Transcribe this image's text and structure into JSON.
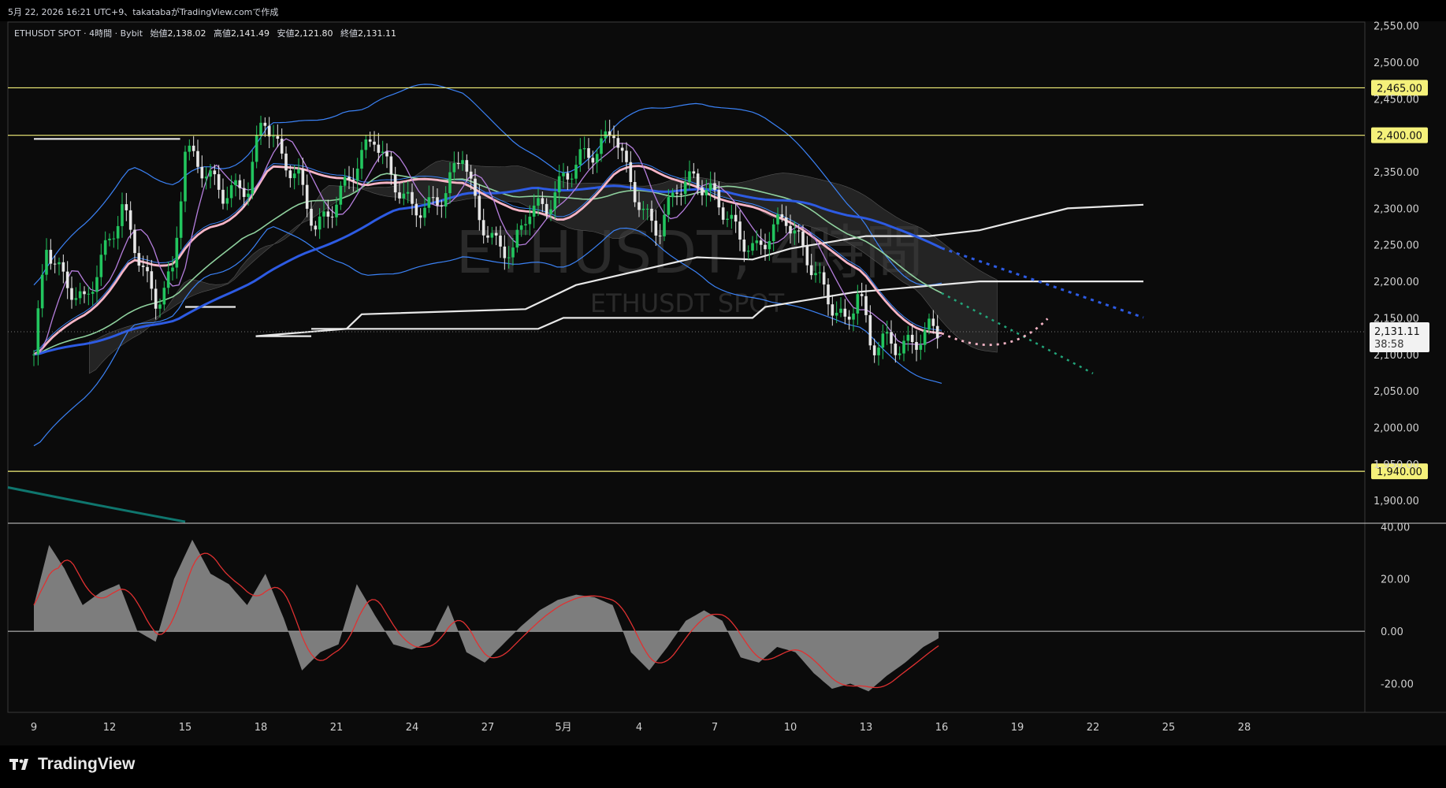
{
  "header": {
    "credit": "5月 22, 2026 16:21 UTC+9、takatabaがTradingView.comで作成"
  },
  "legend": {
    "symbol": "ETHUSDT SPOT · 4時間 · Bybit",
    "open_label": "始値",
    "open": "2,138.02",
    "high_label": "高値",
    "high": "2,141.49",
    "low_label": "安値",
    "low": "2,121.80",
    "close_label": "終値",
    "close": "2,131.11"
  },
  "watermark": {
    "main": "ETHUSDT, 4時間",
    "sub": "ETHUSDT SPOT"
  },
  "footer": {
    "brand": "TradingView"
  },
  "colors": {
    "background": "#0b0b0b",
    "grid_line": "#2a2a2a",
    "candle_up": "#22c55e",
    "candle_down": "#e6e6e6",
    "bollinger": "#3b82f6",
    "ma_fast_purple": "#b57edc",
    "ma_pink": "#f6b5c6",
    "ma_green": "#8fd19e",
    "ma_blue": "#2d5be3",
    "ichimoku_kumo": "#3a3a3a",
    "support_lines": "#e8e8e8",
    "horizontal_levels": "#f5f17a",
    "oscillator_fill": "#8a8a8a",
    "oscillator_signal": "#e03131",
    "teal_line": "#0f766e"
  },
  "chart_data": [
    {
      "type": "candlestick",
      "title": "ETHUSDT, 4時間",
      "x_tick_labels": [
        "9",
        "12",
        "15",
        "18",
        "21",
        "24",
        "27",
        "5月",
        "4",
        "7",
        "10",
        "13",
        "16",
        "19",
        "22",
        "25",
        "28"
      ],
      "y_tick_labels": [
        "2,550.00",
        "2,500.00",
        "2,450.00",
        "2,350.00",
        "2,300.00",
        "2,250.00",
        "2,200.00",
        "2,150.00",
        "2,100.00",
        "2,050.00",
        "2,000.00",
        "1,950.00",
        "1,900.00"
      ],
      "ylim": [
        1870,
        2555
      ],
      "horizontal_levels": [
        {
          "value": 2465,
          "label": "2,465.00"
        },
        {
          "value": 2400,
          "label": "2,400.00"
        },
        {
          "value": 1940,
          "label": "1,940.00"
        }
      ],
      "last_price": {
        "value": 2131.11,
        "label": "2,131.11",
        "countdown": "38:58"
      },
      "close_path": [
        {
          "day": 0.0,
          "value": 2100
        },
        {
          "day": 0.5,
          "value": 2250
        },
        {
          "day": 1.2,
          "value": 2200
        },
        {
          "day": 2.0,
          "value": 2170
        },
        {
          "day": 2.8,
          "value": 2240
        },
        {
          "day": 3.5,
          "value": 2300
        },
        {
          "day": 4.2,
          "value": 2230
        },
        {
          "day": 4.8,
          "value": 2170
        },
        {
          "day": 5.5,
          "value": 2210
        },
        {
          "day": 6.0,
          "value": 2380
        },
        {
          "day": 6.8,
          "value": 2350
        },
        {
          "day": 7.5,
          "value": 2320
        },
        {
          "day": 8.5,
          "value": 2330
        },
        {
          "day": 9.1,
          "value": 2430
        },
        {
          "day": 9.8,
          "value": 2370
        },
        {
          "day": 10.5,
          "value": 2340
        },
        {
          "day": 11.2,
          "value": 2270
        },
        {
          "day": 12.0,
          "value": 2310
        },
        {
          "day": 12.8,
          "value": 2360
        },
        {
          "day": 13.5,
          "value": 2400
        },
        {
          "day": 14.2,
          "value": 2340
        },
        {
          "day": 15.0,
          "value": 2300
        },
        {
          "day": 15.6,
          "value": 2300
        },
        {
          "day": 16.3,
          "value": 2320
        },
        {
          "day": 17.0,
          "value": 2380
        },
        {
          "day": 17.6,
          "value": 2290
        },
        {
          "day": 18.3,
          "value": 2250
        },
        {
          "day": 19.0,
          "value": 2240
        },
        {
          "day": 19.6,
          "value": 2300
        },
        {
          "day": 20.3,
          "value": 2300
        },
        {
          "day": 21.0,
          "value": 2340
        },
        {
          "day": 21.7,
          "value": 2370
        },
        {
          "day": 22.4,
          "value": 2380
        },
        {
          "day": 23.0,
          "value": 2410
        },
        {
          "day": 23.5,
          "value": 2350
        },
        {
          "day": 24.2,
          "value": 2290
        },
        {
          "day": 24.8,
          "value": 2270
        },
        {
          "day": 25.5,
          "value": 2330
        },
        {
          "day": 26.2,
          "value": 2340
        },
        {
          "day": 26.9,
          "value": 2320
        },
        {
          "day": 27.5,
          "value": 2290
        },
        {
          "day": 28.0,
          "value": 2260
        },
        {
          "day": 28.6,
          "value": 2240
        },
        {
          "day": 29.3,
          "value": 2270
        },
        {
          "day": 29.8,
          "value": 2290
        },
        {
          "day": 30.4,
          "value": 2250
        },
        {
          "day": 31.0,
          "value": 2210
        },
        {
          "day": 31.6,
          "value": 2170
        },
        {
          "day": 32.2,
          "value": 2140
        },
        {
          "day": 32.7,
          "value": 2190
        },
        {
          "day": 33.2,
          "value": 2110
        },
        {
          "day": 33.7,
          "value": 2120
        },
        {
          "day": 34.3,
          "value": 2110
        },
        {
          "day": 34.9,
          "value": 2115
        },
        {
          "day": 35.5,
          "value": 2135
        },
        {
          "day": 36.0,
          "value": 2131
        }
      ],
      "support_steps": [
        {
          "from_day": 0,
          "to_day": 5.8,
          "value": 2395
        },
        {
          "from_day": 6.0,
          "to_day": 8.0,
          "value": 2165
        },
        {
          "from_day": 8.8,
          "to_day": 11.0,
          "value": 2125
        }
      ]
    },
    {
      "type": "area",
      "title": "",
      "y_tick_labels": [
        "40.00",
        "20.00",
        "0.00",
        "-20.00"
      ],
      "ylim": [
        -31,
        41
      ],
      "histogram_path": [
        {
          "day": 0.0,
          "value": 10
        },
        {
          "day": 0.5,
          "value": 33
        },
        {
          "day": 1.0,
          "value": 24
        },
        {
          "day": 1.6,
          "value": 10
        },
        {
          "day": 2.2,
          "value": 15
        },
        {
          "day": 2.8,
          "value": 18
        },
        {
          "day": 3.4,
          "value": 0
        },
        {
          "day": 4.0,
          "value": -4
        },
        {
          "day": 4.6,
          "value": 20
        },
        {
          "day": 5.2,
          "value": 35
        },
        {
          "day": 5.8,
          "value": 22
        },
        {
          "day": 6.4,
          "value": 18
        },
        {
          "day": 7.0,
          "value": 10
        },
        {
          "day": 7.6,
          "value": 22
        },
        {
          "day": 8.2,
          "value": 5
        },
        {
          "day": 8.8,
          "value": -15
        },
        {
          "day": 9.4,
          "value": -8
        },
        {
          "day": 10.0,
          "value": -5
        },
        {
          "day": 10.6,
          "value": 18
        },
        {
          "day": 11.2,
          "value": 6
        },
        {
          "day": 11.8,
          "value": -5
        },
        {
          "day": 12.4,
          "value": -7
        },
        {
          "day": 13.0,
          "value": -4
        },
        {
          "day": 13.6,
          "value": 10
        },
        {
          "day": 14.2,
          "value": -8
        },
        {
          "day": 14.8,
          "value": -12
        },
        {
          "day": 15.4,
          "value": -5
        },
        {
          "day": 16.0,
          "value": 2
        },
        {
          "day": 16.6,
          "value": 8
        },
        {
          "day": 17.2,
          "value": 12
        },
        {
          "day": 17.8,
          "value": 14
        },
        {
          "day": 18.4,
          "value": 13
        },
        {
          "day": 19.0,
          "value": 10
        },
        {
          "day": 19.6,
          "value": -8
        },
        {
          "day": 20.2,
          "value": -15
        },
        {
          "day": 20.8,
          "value": -6
        },
        {
          "day": 21.4,
          "value": 4
        },
        {
          "day": 22.0,
          "value": 8
        },
        {
          "day": 22.6,
          "value": 4
        },
        {
          "day": 23.2,
          "value": -10
        },
        {
          "day": 23.8,
          "value": -12
        },
        {
          "day": 24.4,
          "value": -6
        },
        {
          "day": 25.0,
          "value": -8
        },
        {
          "day": 25.6,
          "value": -16
        },
        {
          "day": 26.2,
          "value": -22
        },
        {
          "day": 26.8,
          "value": -20
        },
        {
          "day": 27.4,
          "value": -23
        },
        {
          "day": 28.0,
          "value": -17
        },
        {
          "day": 28.6,
          "value": -12
        },
        {
          "day": 29.2,
          "value": -6
        },
        {
          "day": 29.8,
          "value": -2
        }
      ]
    }
  ]
}
